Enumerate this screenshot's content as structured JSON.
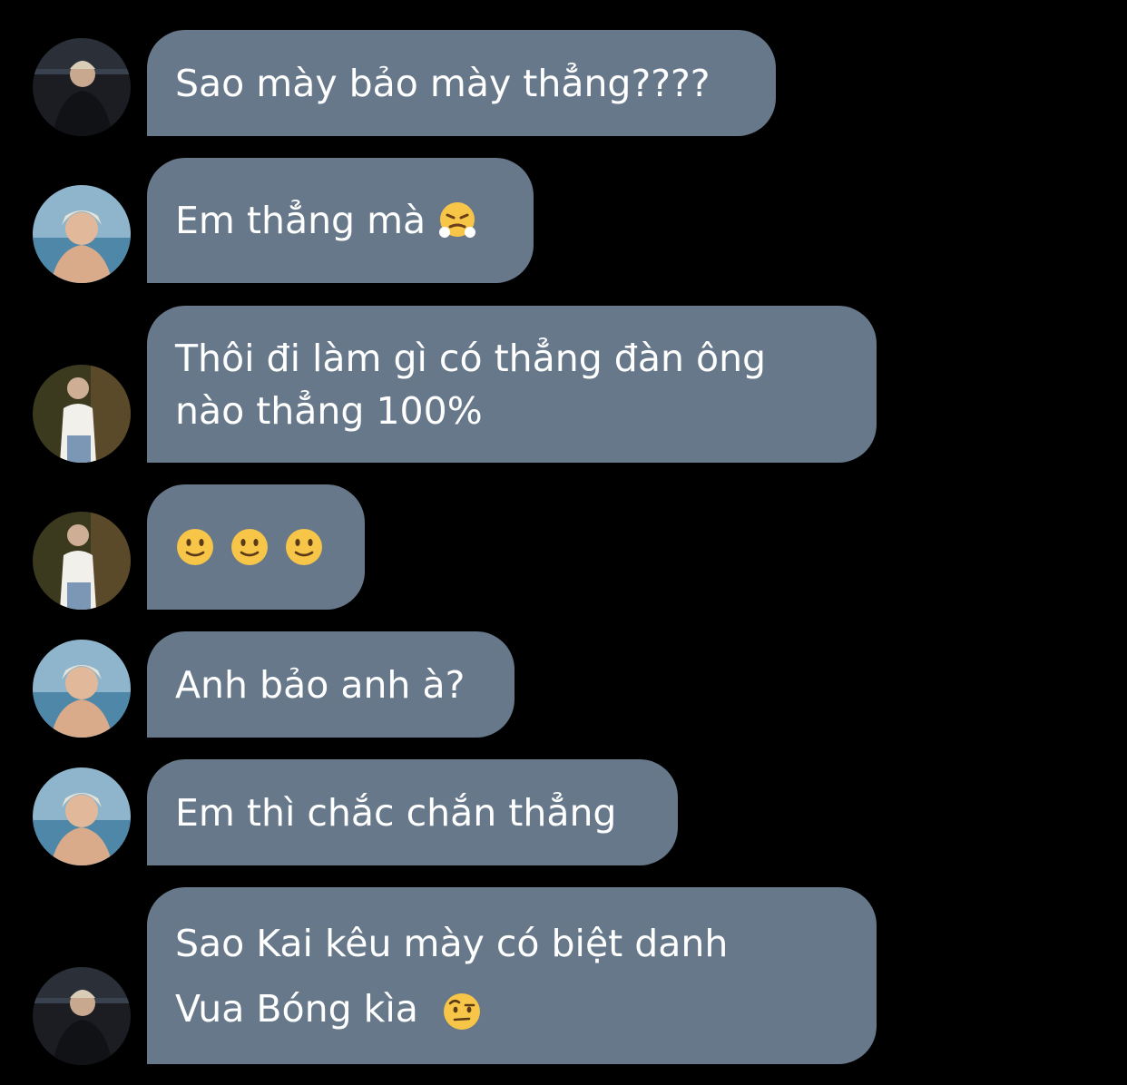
{
  "messages": [
    {
      "id": "m1",
      "text": "Sao mày bảo mày thẳng????",
      "avatar": "avatar-dark",
      "emoji": null
    },
    {
      "id": "m2",
      "text": "Em thẳng mà",
      "avatar": "avatar-beach",
      "emoji": "face-with-steam-emoji"
    },
    {
      "id": "m3",
      "line1": "Thôi đi làm gì có thẳng đàn ông",
      "line2": "nào thẳng 100%",
      "avatar": "avatar-white-shirt",
      "emoji": null
    },
    {
      "id": "m4",
      "text": "",
      "avatar": "avatar-white-shirt",
      "emoji": "slightly-smiling-face-emoji x3"
    },
    {
      "id": "m5",
      "text": "Anh bảo anh à?",
      "avatar": "avatar-beach",
      "emoji": null
    },
    {
      "id": "m6",
      "text": "Em thì chắc chắn thẳng",
      "avatar": "avatar-beach",
      "emoji": null
    },
    {
      "id": "m7",
      "line1": "Sao Kai kêu mày có biệt danh",
      "line2": "Vua Bóng kìa",
      "avatar": "avatar-dark",
      "emoji": "face-with-raised-eyebrow-emoji"
    }
  ],
  "colors": {
    "background": "#000000",
    "bubble": "#66788a",
    "text": "#ffffff"
  }
}
